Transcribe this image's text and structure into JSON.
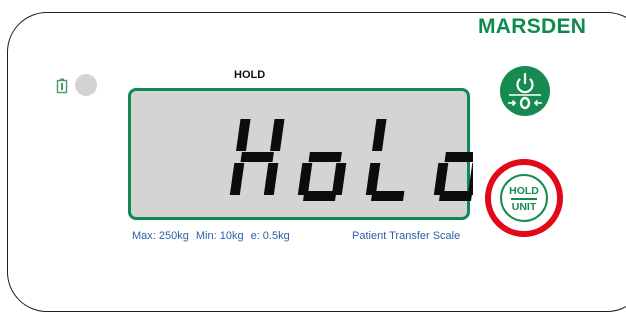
{
  "brand": {
    "name": "MARSDEN",
    "color": "#0d8a4e"
  },
  "indicators": {
    "battery_icon": "battery-icon",
    "status_led_color": "#d3d3d3"
  },
  "display": {
    "hold_label": "HOLD",
    "hold_arrow_icon": "triangle-up-icon",
    "reading": "HoLd",
    "lcd_background": "#d4d4d4",
    "lcd_border": "#0f8a52"
  },
  "specs": {
    "max": "Max: 250kg",
    "min": "Min: 10kg",
    "e": "e: 0.5kg",
    "scale_type": "Patient Transfer Scale"
  },
  "buttons": {
    "power_zero": {
      "icons": [
        "power-icon",
        "zero-icon"
      ],
      "color": "#168a50"
    },
    "hold_unit": {
      "top_label": "HOLD",
      "bottom_label": "UNIT",
      "highlight_color": "#e1081a"
    }
  }
}
